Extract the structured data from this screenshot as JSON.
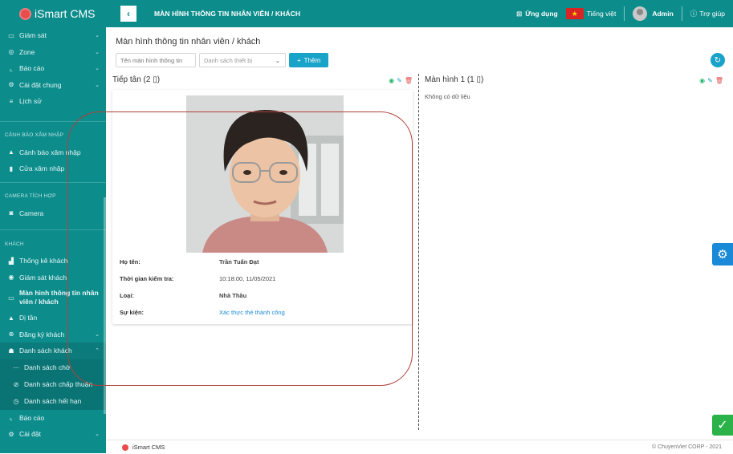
{
  "app": {
    "name": "iSmart CMS"
  },
  "header": {
    "back_icon": "chevron-left",
    "title": "MÀN HÌNH THÔNG TIN NHÂN VIÊN / KHÁCH",
    "apps_label": "Ứng dụng",
    "language_label": "Tiếng việt",
    "user_label": "Admin",
    "help_label": "Trợ giúp"
  },
  "sidebar": {
    "items_top": [
      {
        "label": "Giám sát",
        "icon": "monitor-icon",
        "chev": "⌄"
      },
      {
        "label": "Zone",
        "icon": "location-icon",
        "chev": "⌄"
      },
      {
        "label": "Báo cáo",
        "icon": "chart-icon",
        "chev": "⌄"
      },
      {
        "label": "Cài đặt chung",
        "icon": "gear-icon",
        "chev": "⌄"
      },
      {
        "label": "Lịch sử",
        "icon": "list-icon",
        "chev": ""
      }
    ],
    "section_intrusion": "CẢNH BÁO XÂM NHẬP",
    "items_intrusion": [
      {
        "label": "Cảnh báo xâm nhập",
        "icon": "warning-icon"
      },
      {
        "label": "Cửa xâm nhập",
        "icon": "door-icon"
      }
    ],
    "section_camera": "CAMERA TÍCH HỢP",
    "items_camera": [
      {
        "label": "Camera",
        "icon": "camera-icon"
      }
    ],
    "section_guest": "KHÁCH",
    "items_guest": [
      {
        "label": "Thống kê khách",
        "icon": "bar-chart-icon"
      },
      {
        "label": "Giám sát khách",
        "icon": "eye-icon"
      },
      {
        "label": "Màn hình thông tin nhân viên / khách",
        "icon": "screen-icon"
      },
      {
        "label": "Dị tần",
        "icon": "warning-icon"
      },
      {
        "label": "Đăng ký khách",
        "icon": "plus-circle-icon",
        "chev": "⌄"
      },
      {
        "label": "Danh sách khách",
        "icon": "users-icon",
        "chev": "⌃"
      }
    ],
    "sub_items": [
      {
        "label": "Danh sách chờ",
        "icon": "dots-icon"
      },
      {
        "label": "Danh sách chấp thuận",
        "icon": "check-circle-icon"
      },
      {
        "label": "Danh sách hết hạn",
        "icon": "clock-icon"
      }
    ],
    "items_bottom": [
      {
        "label": "Báo cáo",
        "icon": "chart-icon",
        "chev": ""
      },
      {
        "label": "Cài đặt",
        "icon": "gear-icon",
        "chev": "⌄"
      }
    ]
  },
  "main": {
    "page_title": "Màn hình thông tin nhân viên / khách",
    "search_placeholder": "Tên màn hình thông tin",
    "device_select": "Danh sách thiết bị",
    "add_button": "Thêm",
    "columns": [
      {
        "title": "Tiếp tân (2 ▯)",
        "card": {
          "fields": [
            {
              "key": "Họ tên:",
              "value": "Trần Tuấn Đạt",
              "style": "bold"
            },
            {
              "key": "Thời gian kiểm tra:",
              "value": "10:18:00, 11/05/2021",
              "style": ""
            },
            {
              "key": "Loại:",
              "value": "Nhà Thầu",
              "style": "bold"
            },
            {
              "key": "Sự kiện:",
              "value": "Xác thực thẻ thành công",
              "style": "link"
            }
          ]
        }
      },
      {
        "title": "Màn hình 1 (1 ▯)",
        "empty_text": "Không có dữ liệu"
      }
    ]
  },
  "footer": {
    "brand": "iSmart CMS",
    "copyright": "© ChuyenViet CORP - 2021"
  },
  "colors": {
    "primary": "#0d8c8c",
    "accent": "#1aa3c9",
    "annotation": "#b0413a",
    "success": "#2bb34a"
  }
}
